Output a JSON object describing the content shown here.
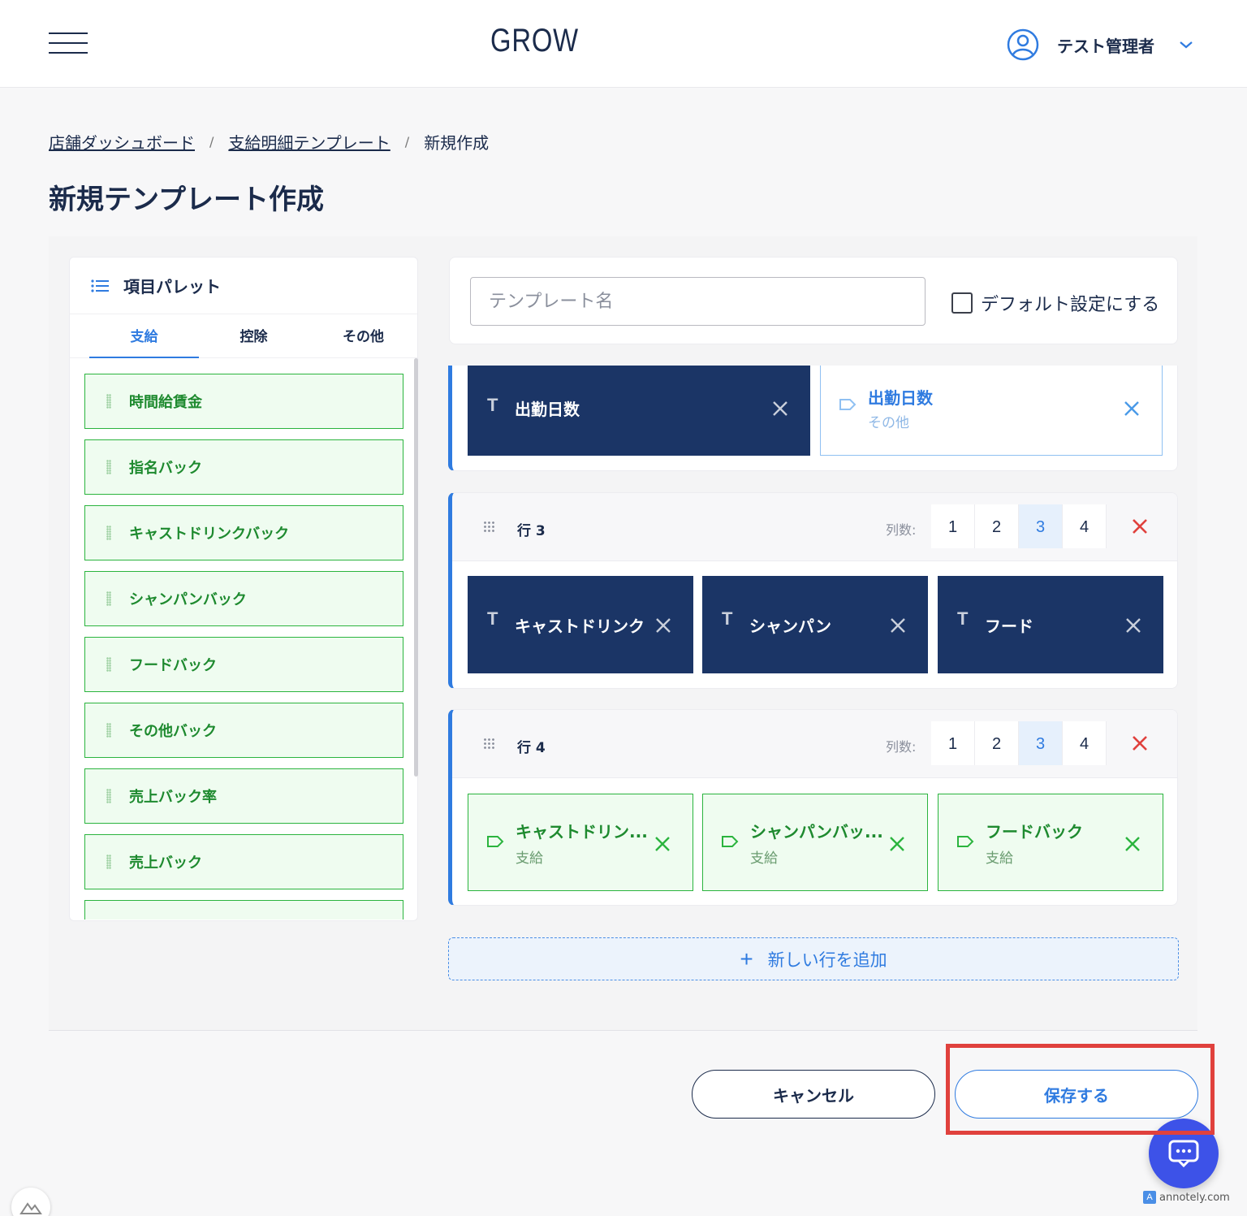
{
  "header": {
    "logo": "GROW",
    "user_name": "テスト管理者"
  },
  "breadcrumb": {
    "items": [
      "店舗ダッシュボード",
      "支給明細テンプレート"
    ],
    "current": "新規作成",
    "separator": "/"
  },
  "page_title": "新規テンプレート作成",
  "palette": {
    "title": "項目パレット",
    "tabs": [
      "支給",
      "控除",
      "その他"
    ],
    "active_tab": "支給",
    "items": [
      "時間給賃金",
      "指名バック",
      "キャストドリンクバック",
      "シャンパンバック",
      "フードバック",
      "その他バック",
      "売上バック率",
      "売上バック"
    ]
  },
  "template_form": {
    "name_placeholder": "テンプレート名",
    "name_value": "",
    "default_checkbox_label": "デフォルト設定にする",
    "default_checked": false
  },
  "rows": {
    "cols_label": "列数:",
    "col_options": [
      "1",
      "2",
      "3",
      "4"
    ],
    "row2": {
      "cells": [
        {
          "type": "text",
          "title": "出勤日数"
        },
        {
          "type": "item",
          "title": "出勤日数",
          "category": "その他"
        }
      ]
    },
    "row3": {
      "label": "行 3",
      "selected_cols": "3",
      "cells": [
        {
          "type": "text",
          "title": "キャストドリンク"
        },
        {
          "type": "text",
          "title": "シャンパン"
        },
        {
          "type": "text",
          "title": "フード"
        }
      ]
    },
    "row4": {
      "label": "行 4",
      "selected_cols": "3",
      "cells": [
        {
          "type": "item",
          "title": "キャストドリン...",
          "category": "支給"
        },
        {
          "type": "item",
          "title": "シャンパンバッ...",
          "category": "支給"
        },
        {
          "type": "item",
          "title": "フードバック",
          "category": "支給"
        }
      ]
    }
  },
  "text_icon": "T",
  "add_row_label": "新しい行を追加",
  "add_row_icon": "+",
  "buttons": {
    "cancel": "キャンセル",
    "save": "保存する"
  },
  "watermark": "annotely.com",
  "watermark_logo": "A",
  "icons": {
    "menu": "hamburger-icon",
    "user": "user-circle-icon",
    "dropdown": "chevron-down-icon",
    "palette": "list-icon",
    "drag": "drag-handle-icon",
    "text_cell": "text-type-icon",
    "item_cell": "tag-icon",
    "remove": "close-icon",
    "chat": "chat-icon"
  },
  "colors": {
    "primary": "#2f7be0",
    "navy": "#1b3566",
    "green": "#2bb43e",
    "danger": "#e0413d",
    "chat": "#3d52e8"
  }
}
